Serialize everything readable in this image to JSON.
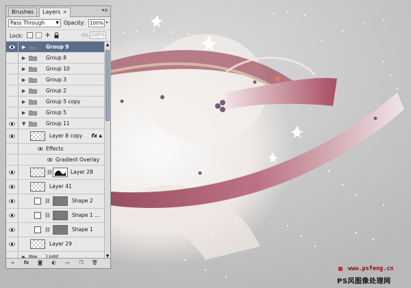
{
  "tabs": [
    {
      "label": "Brushes",
      "active": false
    },
    {
      "label": "Layers",
      "active": true,
      "close": "×"
    }
  ],
  "panel_menu_icon": "panel-menu-icon",
  "blend_mode": "Pass Through",
  "opacity_label": "Opacity:",
  "opacity_value": "100%",
  "lock_label": "Lock:",
  "fill_label": "Fill:",
  "fill_value": "100%",
  "layers": [
    {
      "name": "Group 9",
      "kind": "group",
      "visible": true,
      "selected": true
    },
    {
      "name": "Group 8",
      "kind": "group",
      "visible": false
    },
    {
      "name": "Group 10",
      "kind": "group",
      "visible": false
    },
    {
      "name": "Group 3",
      "kind": "group",
      "visible": false
    },
    {
      "name": "Group 2",
      "kind": "group",
      "visible": false
    },
    {
      "name": "Group 5 copy",
      "kind": "group",
      "visible": false
    },
    {
      "name": "Group 5",
      "kind": "group",
      "visible": false
    },
    {
      "name": "Group 11",
      "kind": "group",
      "visible": true,
      "expanded": true
    },
    {
      "name": "Layer 8 copy",
      "kind": "layer",
      "visible": true,
      "fx": "fx"
    },
    {
      "name": "Effects",
      "kind": "effects-header"
    },
    {
      "name": "Gradient Overlay",
      "kind": "effect"
    },
    {
      "name": "Layer 28",
      "kind": "layer-mask",
      "visible": true
    },
    {
      "name": "Layer 41",
      "kind": "layer",
      "visible": true
    },
    {
      "name": "Shape 2",
      "kind": "shape",
      "visible": true
    },
    {
      "name": "Shape 1 ...",
      "kind": "shape",
      "visible": true
    },
    {
      "name": "Shape 1",
      "kind": "shape",
      "visible": true
    },
    {
      "name": "Layer 29",
      "kind": "layer",
      "visible": true
    },
    {
      "name": "Light",
      "kind": "group",
      "visible": false
    }
  ],
  "bottom_icons": [
    "link-icon",
    "fx-icon",
    "mask-icon",
    "adjustment-icon",
    "folder-icon",
    "new-layer-icon",
    "trash-icon"
  ],
  "watermark": {
    "url": "www.psfeng.cn",
    "cn": "PS风图像处理网"
  },
  "colors": {
    "selected_row": "#5a6e8c",
    "ribbon": "#b05868",
    "watermark_red": "#8b0b0b"
  }
}
